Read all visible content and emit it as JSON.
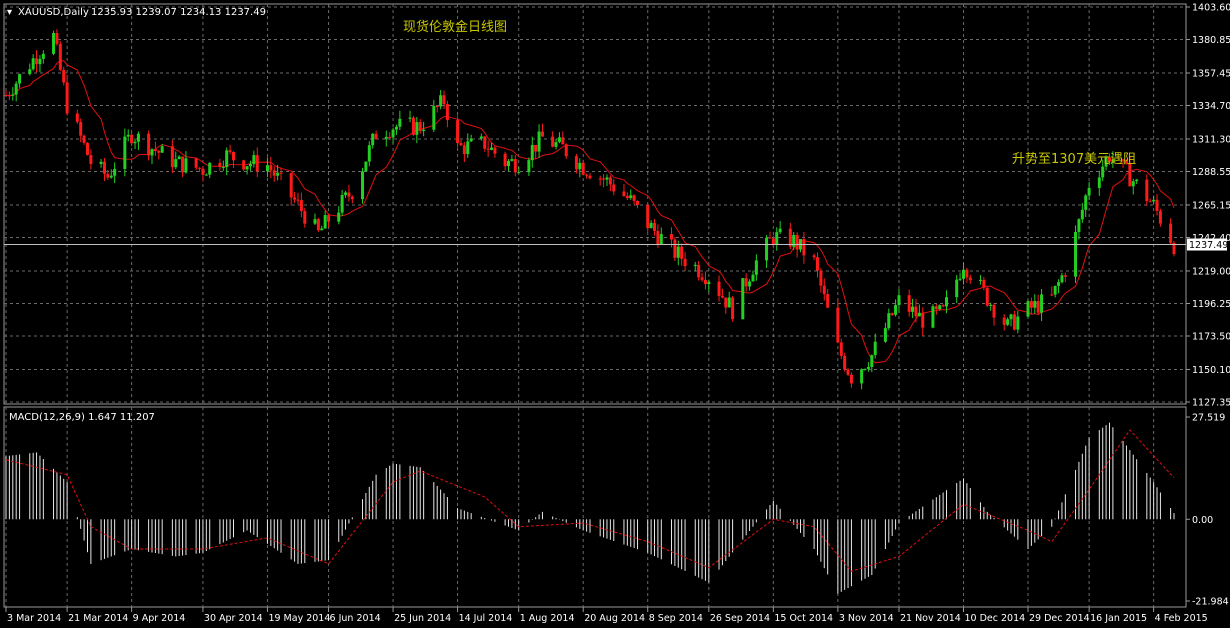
{
  "header": {
    "symbol": "XAUUSD,Daily",
    "ohlc": "1235.93 1239.07 1234.13 1237.49"
  },
  "chart_data": [
    {
      "type": "candlestick",
      "title": "现货伦敦金日线图",
      "annotation": "升势至1307美元遇阻",
      "ylim": [
        1127.35,
        1403.6
      ],
      "y_ticks": [
        "1403.60",
        "1380.85",
        "1357.45",
        "1334.70",
        "1311.30",
        "1288.55",
        "1265.15",
        "1242.40",
        "1219.00",
        "1196.25",
        "1173.50",
        "1150.10",
        "1127.35"
      ],
      "last_price": "1237.49",
      "x_labels": [
        "3 Mar 2014",
        "21 Mar 2014",
        "9 Apr 2014",
        "30 Apr 2014",
        "19 May 2014",
        "6 Jun 2014",
        "25 Jun 2014",
        "14 Jul 2014",
        "1 Aug 2014",
        "20 Aug 2014",
        "8 Sep 2014",
        "26 Sep 2014",
        "15 Oct 2014",
        "3 Nov 2014",
        "21 Nov 2014",
        "10 Dec 2014",
        "29 Dec 2014",
        "16 Jan 2015",
        "4 Feb 2015"
      ],
      "close_path": [
        [
          "3 Mar 2014",
          1342
        ],
        [
          "12 Mar 2014",
          1370
        ],
        [
          "17 Mar 2014",
          1383
        ],
        [
          "21 Mar 2014",
          1335
        ],
        [
          "28 Mar 2014",
          1295
        ],
        [
          "2 Apr 2014",
          1285
        ],
        [
          "9 Apr 2014",
          1315
        ],
        [
          "15 Apr 2014",
          1305
        ],
        [
          "22 Apr 2014",
          1295
        ],
        [
          "30 Apr 2014",
          1290
        ],
        [
          "7 May 2014",
          1300
        ],
        [
          "13 May 2014",
          1295
        ],
        [
          "19 May 2014",
          1293
        ],
        [
          "28 May 2014",
          1265
        ],
        [
          "3 Jun 2014",
          1245
        ],
        [
          "6 Jun 2014",
          1255
        ],
        [
          "13 Jun 2014",
          1275
        ],
        [
          "20 Jun 2014",
          1315
        ],
        [
          "25 Jun 2014",
          1320
        ],
        [
          "3 Jul 2014",
          1320
        ],
        [
          "10 Jul 2014",
          1338
        ],
        [
          "14 Jul 2014",
          1305
        ],
        [
          "22 Jul 2014",
          1308
        ],
        [
          "28 Jul 2014",
          1295
        ],
        [
          "1 Aug 2014",
          1295
        ],
        [
          "8 Aug 2014",
          1312
        ],
        [
          "14 Aug 2014",
          1305
        ],
        [
          "20 Aug 2014",
          1292
        ],
        [
          "27 Aug 2014",
          1282
        ],
        [
          "3 Sep 2014",
          1268
        ],
        [
          "8 Sep 2014",
          1252
        ],
        [
          "16 Sep 2014",
          1232
        ],
        [
          "22 Sep 2014",
          1222
        ],
        [
          "26 Sep 2014",
          1215
        ],
        [
          "3 Oct 2014",
          1192
        ],
        [
          "9 Oct 2014",
          1222
        ],
        [
          "15 Oct 2014",
          1243
        ],
        [
          "21 Oct 2014",
          1240
        ],
        [
          "27 Oct 2014",
          1225
        ],
        [
          "3 Nov 2014",
          1165
        ],
        [
          "7 Nov 2014",
          1145
        ],
        [
          "13 Nov 2014",
          1160
        ],
        [
          "21 Nov 2014",
          1198
        ],
        [
          "28 Nov 2014",
          1185
        ],
        [
          "4 Dec 2014",
          1190
        ],
        [
          "10 Dec 2014",
          1225
        ],
        [
          "17 Dec 2014",
          1200
        ],
        [
          "23 Dec 2014",
          1180
        ],
        [
          "29 Dec 2014",
          1192
        ],
        [
          "5 Jan 2015",
          1200
        ],
        [
          "10 Jan 2015",
          1225
        ],
        [
          "16 Jan 2015",
          1280
        ],
        [
          "22 Jan 2015",
          1300
        ],
        [
          "28 Jan 2015",
          1285
        ],
        [
          "4 Feb 2015",
          1265
        ],
        [
          "10 Feb 2015",
          1237.49
        ]
      ]
    },
    {
      "type": "histogram",
      "title": "MACD(12,26,9) 1.647 11.207",
      "ylim": [
        -21.984,
        27.519
      ],
      "y_ticks": [
        "27.519",
        "0.00",
        "-21.984"
      ],
      "macd_path": [
        [
          "3 Mar 2014",
          17
        ],
        [
          "12 Mar 2014",
          18
        ],
        [
          "21 Mar 2014",
          10
        ],
        [
          "28 Mar 2014",
          -12
        ],
        [
          "9 Apr 2014",
          -8
        ],
        [
          "22 Apr 2014",
          -10
        ],
        [
          "30 Apr 2014",
          -9
        ],
        [
          "13 May 2014",
          -3
        ],
        [
          "28 May 2014",
          -12
        ],
        [
          "6 Jun 2014",
          -11
        ],
        [
          "20 Jun 2014",
          12
        ],
        [
          "25 Jun 2014",
          15
        ],
        [
          "3 Jul 2014",
          14
        ],
        [
          "14 Jul 2014",
          3
        ],
        [
          "1 Aug 2014",
          -3
        ],
        [
          "8 Aug 2014",
          2
        ],
        [
          "20 Aug 2014",
          -3
        ],
        [
          "8 Sep 2014",
          -9
        ],
        [
          "26 Sep 2014",
          -17
        ],
        [
          "9 Oct 2014",
          -2
        ],
        [
          "15 Oct 2014",
          5
        ],
        [
          "27 Oct 2014",
          -8
        ],
        [
          "3 Nov 2014",
          -20
        ],
        [
          "13 Nov 2014",
          -15
        ],
        [
          "21 Nov 2014",
          -1
        ],
        [
          "10 Dec 2014",
          11
        ],
        [
          "17 Dec 2014",
          2
        ],
        [
          "29 Dec 2014",
          -8
        ],
        [
          "5 Jan 2015",
          -2
        ],
        [
          "16 Jan 2015",
          22
        ],
        [
          "22 Jan 2015",
          26
        ],
        [
          "4 Feb 2015",
          10
        ],
        [
          "10 Feb 2015",
          1.647
        ]
      ],
      "signal_path": [
        [
          "3 Mar 2014",
          16
        ],
        [
          "21 Mar 2014",
          12
        ],
        [
          "28 Mar 2014",
          -2
        ],
        [
          "9 Apr 2014",
          -8
        ],
        [
          "30 Apr 2014",
          -8
        ],
        [
          "19 May 2014",
          -5
        ],
        [
          "6 Jun 2014",
          -12
        ],
        [
          "25 Jun 2014",
          10
        ],
        [
          "3 Jul 2014",
          13
        ],
        [
          "22 Jul 2014",
          6
        ],
        [
          "1 Aug 2014",
          -2
        ],
        [
          "20 Aug 2014",
          -1
        ],
        [
          "8 Sep 2014",
          -6
        ],
        [
          "26 Sep 2014",
          -13
        ],
        [
          "15 Oct 2014",
          0
        ],
        [
          "27 Oct 2014",
          -2
        ],
        [
          "7 Nov 2014",
          -14
        ],
        [
          "21 Nov 2014",
          -10
        ],
        [
          "10 Dec 2014",
          4
        ],
        [
          "29 Dec 2014",
          -3
        ],
        [
          "5 Jan 2015",
          -6
        ],
        [
          "16 Jan 2015",
          8
        ],
        [
          "28 Jan 2015",
          24
        ],
        [
          "10 Feb 2015",
          11.207
        ]
      ]
    }
  ]
}
